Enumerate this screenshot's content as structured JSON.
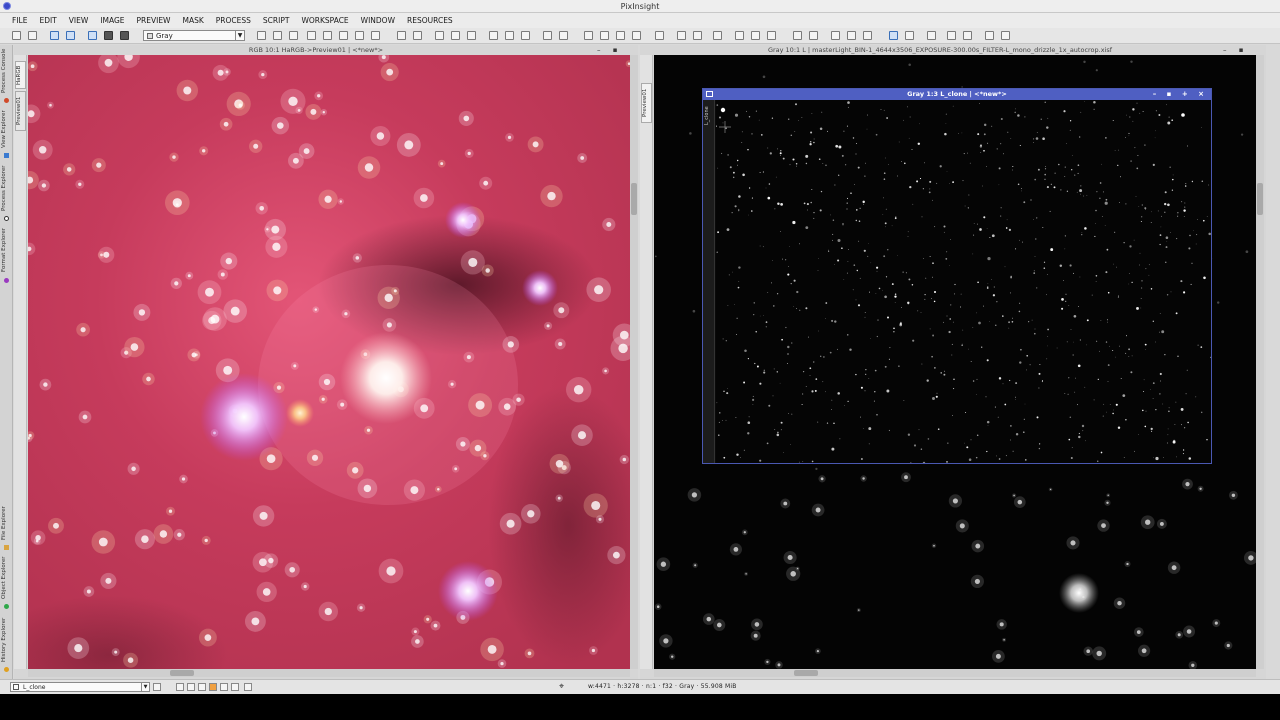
{
  "app": {
    "title": "PixInsight"
  },
  "menu": [
    "FILE",
    "EDIT",
    "VIEW",
    "IMAGE",
    "PREVIEW",
    "MASK",
    "PROCESS",
    "SCRIPT",
    "WORKSPACE",
    "WINDOW",
    "RESOURCES"
  ],
  "toolbar": {
    "channel_select": "Gray"
  },
  "side_panel": {
    "tabs": [
      "Process Console",
      "View Explorer",
      "Process Explorer",
      "Format Explorer",
      "File Explorer",
      "Object Explorer",
      "History Explorer"
    ]
  },
  "left_window": {
    "title": "RGB 10:1 HaRGB->Preview01 | <*new*>",
    "tabs": [
      "HaRGB",
      "Preview01"
    ],
    "buttons": "– ▪ + ×"
  },
  "right_window": {
    "title": "Gray 10:1 L | masterLight_BIN-1_4644x3506_EXPOSURE-300.00s_FILTER-L_mono_drizzle_1x_autocrop.xisf",
    "tabs": [
      "Preview01"
    ],
    "buttons": "– ▪ + ×"
  },
  "sub_window": {
    "title": "Gray 1:3 L_clone | <*new*>",
    "tab": "L_clone",
    "buttons": "– ▪ + ×"
  },
  "status": {
    "view": "L_clone",
    "info": "w:4471 · h:3278 · n:1 · f32 · Gray · 55.908 MiB"
  },
  "icons": [
    "app-icon",
    "undo-icon",
    "redo-icon",
    "crosshair-icon"
  ]
}
